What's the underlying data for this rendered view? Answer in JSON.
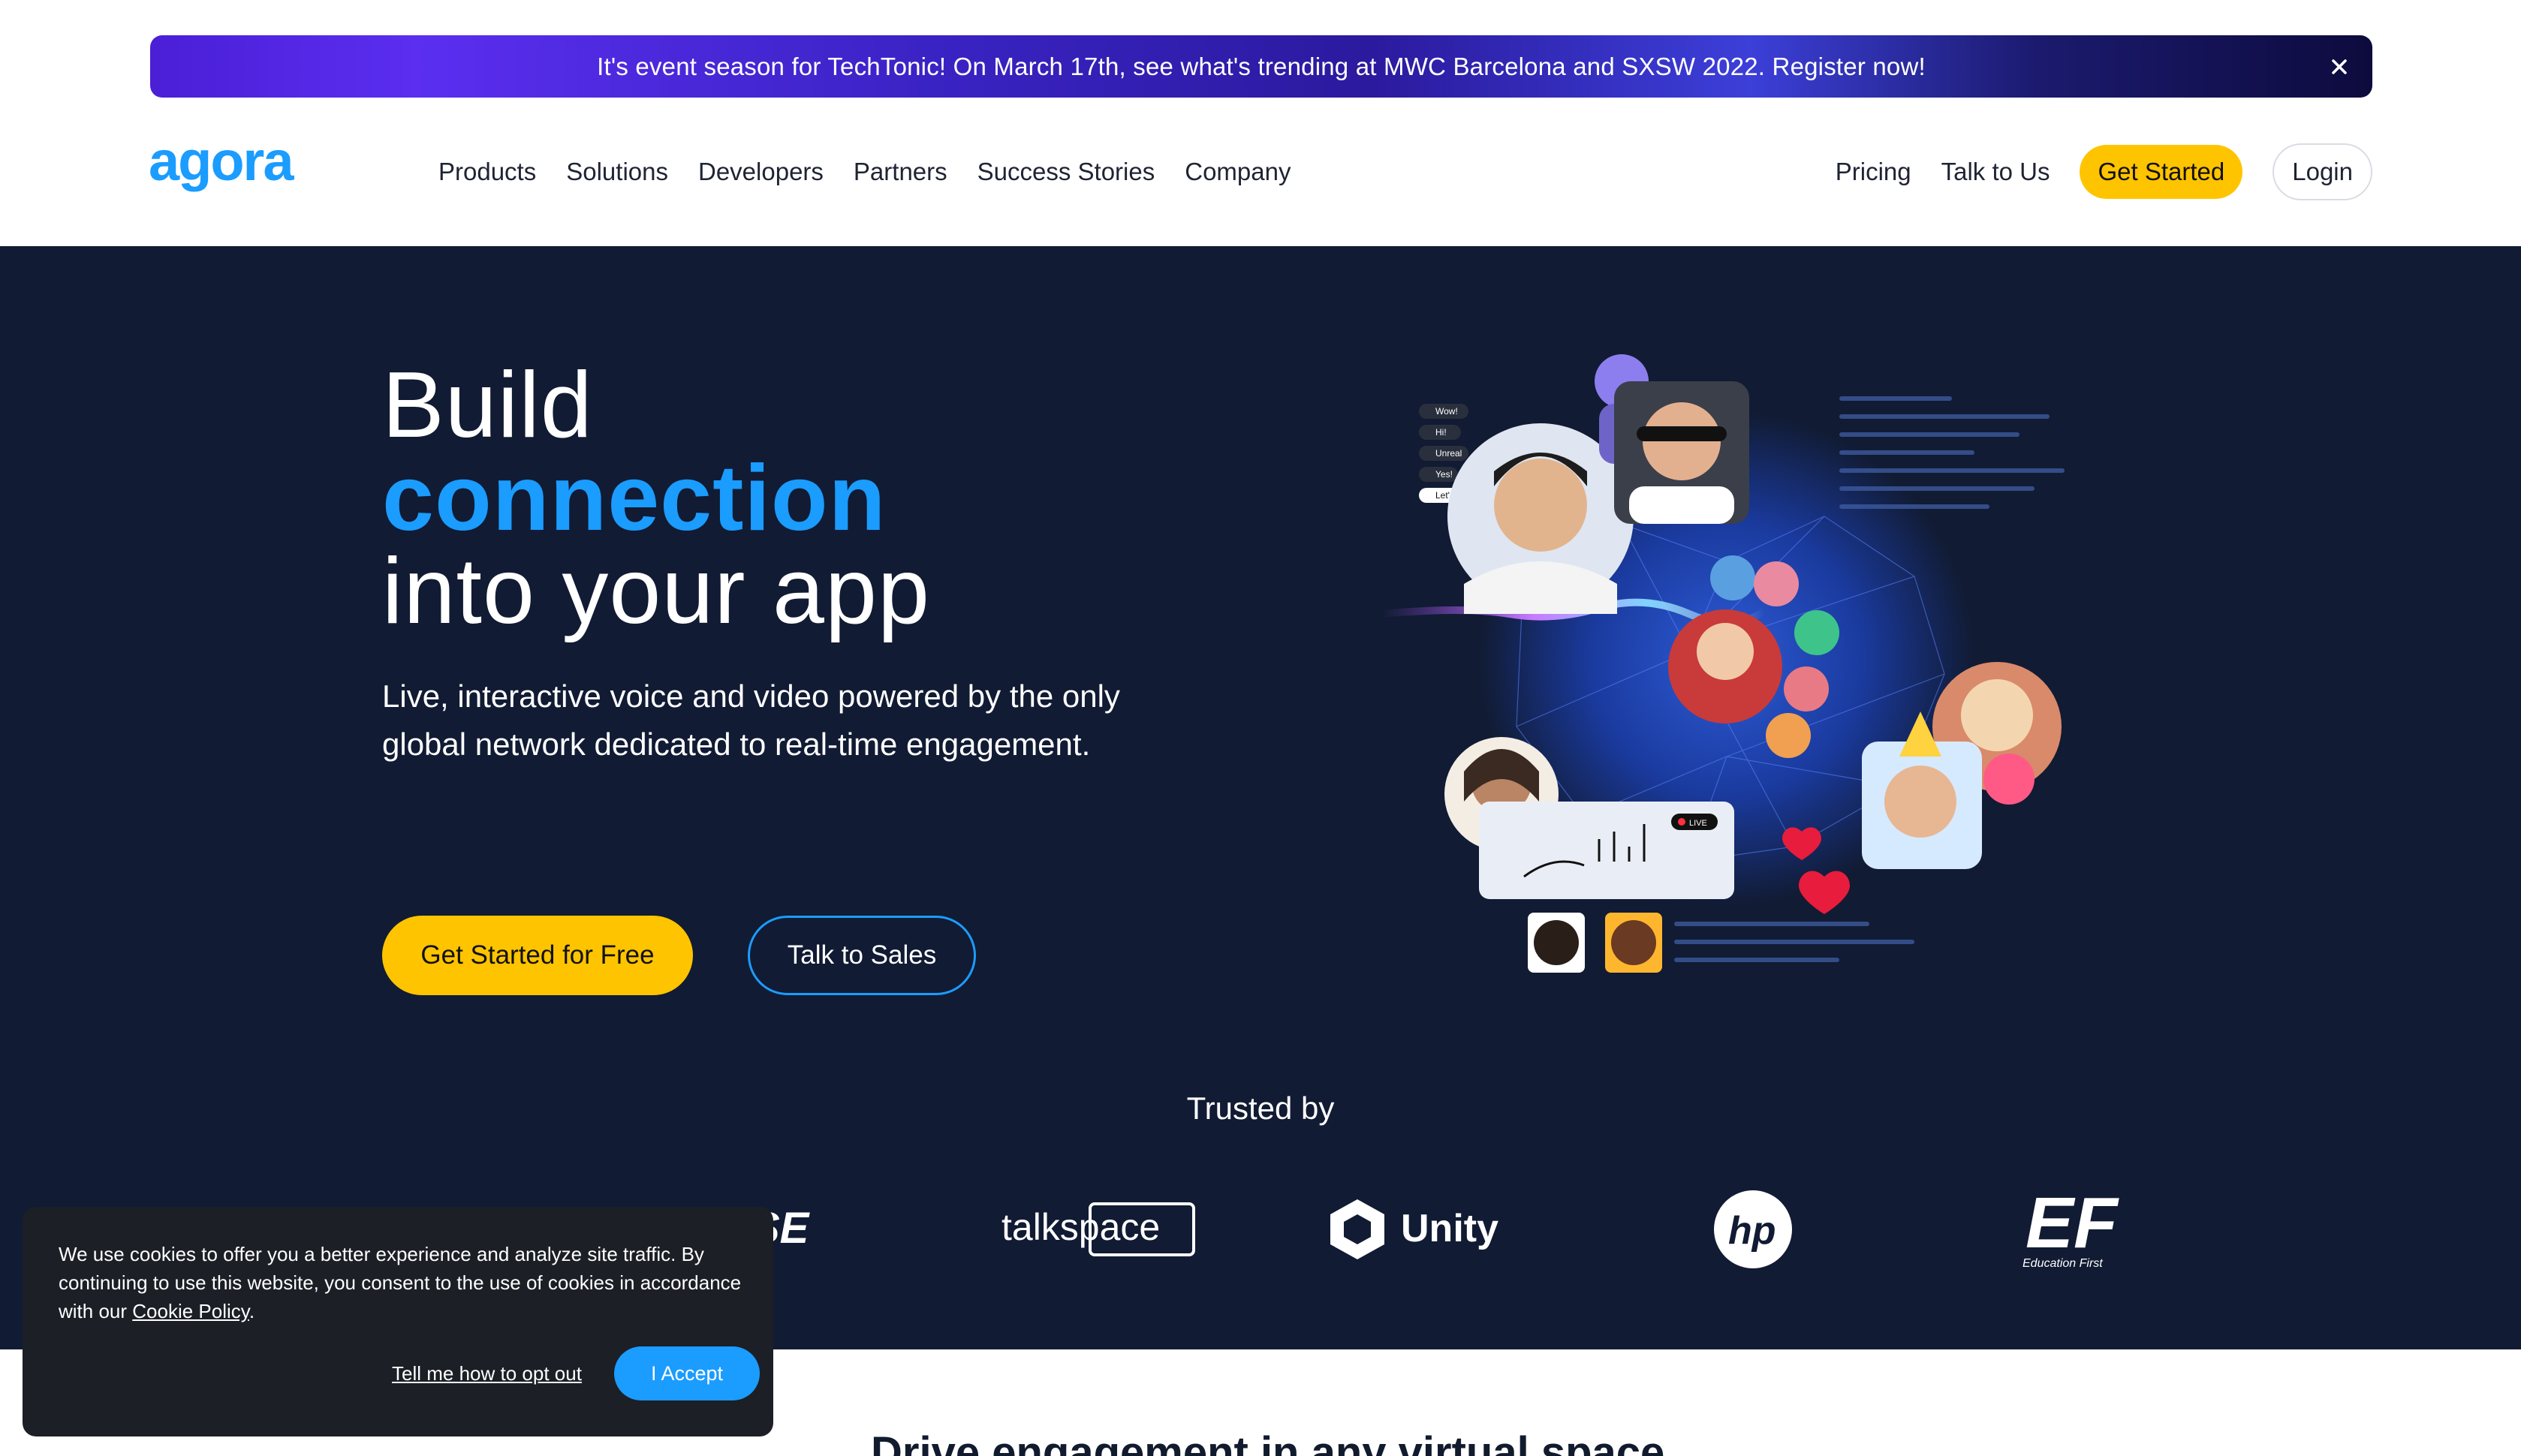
{
  "banner": {
    "text": "It's event season for TechTonic! On March 17th, see what's trending at MWC Barcelona and SXSW 2022. Register now!",
    "close_icon": "close-icon"
  },
  "nav": {
    "logo_text": "agora",
    "links": [
      "Products",
      "Solutions",
      "Developers",
      "Partners",
      "Success Stories",
      "Company"
    ],
    "pricing": "Pricing",
    "talk": "Talk to Us",
    "get_started": "Get Started",
    "login": "Login"
  },
  "hero": {
    "line1": "Build",
    "line2": "connection",
    "line3": "into your app",
    "subtitle": "Live, interactive voice and video powered by the only global network dedicated to real-time engagement.",
    "primary_cta": "Get Started for Free",
    "secondary_cta": "Talk to Sales",
    "chat_tags": [
      "Wow!",
      "Hi!",
      "Unreal",
      "Yes!",
      "Let's go!"
    ],
    "live_badge": "LIVE"
  },
  "trusted": {
    "title": "Trusted by",
    "logos": [
      "SE",
      "talkspace",
      "Unity",
      "hp",
      "Education First"
    ]
  },
  "section2": {
    "heading": "Drive engagement in any virtual space"
  },
  "cookie": {
    "text_before": "We use cookies to offer you a better experience and analyze site traffic. By continuing to use this website, you consent to the use of cookies in accordance with our ",
    "policy_link": "Cookie Policy",
    "text_after": ".",
    "opt_out": "Tell me how to opt out",
    "accept": "I Accept"
  },
  "colors": {
    "accent_blue": "#1b9cff",
    "brand_yellow": "#ffc400",
    "hero_bg": "#111b33"
  }
}
